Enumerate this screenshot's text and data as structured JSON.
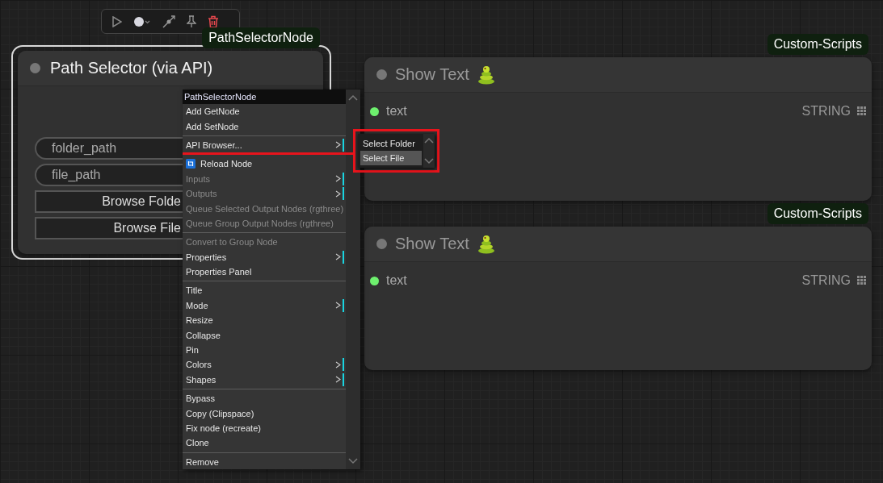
{
  "nodes": [
    {
      "badge": "PathSelectorNode",
      "title": "Path Selector (via API)",
      "selected": true,
      "widgets": [
        {
          "kind": "field",
          "label": "folder_path"
        },
        {
          "kind": "field",
          "label": "file_path"
        },
        {
          "kind": "button",
          "label": "Browse Folde"
        },
        {
          "kind": "button",
          "label": "Browse File"
        }
      ]
    },
    {
      "badge": "Custom-Scripts",
      "title": "Show Text",
      "selected": false,
      "inputs": [
        {
          "label": "text"
        }
      ],
      "outputs": [
        {
          "label": "STRING"
        }
      ]
    },
    {
      "badge": "Custom-Scripts",
      "title": "Show Text",
      "selected": false,
      "inputs": [
        {
          "label": "text"
        }
      ],
      "outputs": [
        {
          "label": "STRING"
        }
      ]
    }
  ],
  "context_menu": {
    "title": "PathSelectorNode",
    "items": [
      {
        "kind": "item",
        "label": "Add GetNode",
        "disabled": false,
        "submenu": false
      },
      {
        "kind": "item",
        "label": "Add SetNode",
        "disabled": false,
        "submenu": false
      },
      {
        "kind": "separator"
      },
      {
        "kind": "item",
        "label": "API Browser...",
        "disabled": false,
        "submenu": true
      },
      {
        "kind": "separator"
      },
      {
        "kind": "icon-item",
        "label": "Reload Node",
        "disabled": false,
        "submenu": false
      },
      {
        "kind": "item",
        "label": "Inputs",
        "disabled": true,
        "submenu": true
      },
      {
        "kind": "item",
        "label": "Outputs",
        "disabled": true,
        "submenu": true
      },
      {
        "kind": "item",
        "label": "Queue Selected Output Nodes (rgthree)",
        "disabled": true,
        "submenu": false
      },
      {
        "kind": "item",
        "label": "Queue Group Output Nodes (rgthree)",
        "disabled": true,
        "submenu": false
      },
      {
        "kind": "separator"
      },
      {
        "kind": "item",
        "label": "Convert to Group Node",
        "disabled": true,
        "submenu": false
      },
      {
        "kind": "item",
        "label": "Properties",
        "disabled": false,
        "submenu": true
      },
      {
        "kind": "item",
        "label": "Properties Panel",
        "disabled": false,
        "submenu": false
      },
      {
        "kind": "separator"
      },
      {
        "kind": "item",
        "label": "Title",
        "disabled": false,
        "submenu": false
      },
      {
        "kind": "item",
        "label": "Mode",
        "disabled": false,
        "submenu": true
      },
      {
        "kind": "item",
        "label": "Resize",
        "disabled": false,
        "submenu": false
      },
      {
        "kind": "item",
        "label": "Collapse",
        "disabled": false,
        "submenu": false
      },
      {
        "kind": "item",
        "label": "Pin",
        "disabled": false,
        "submenu": false
      },
      {
        "kind": "item",
        "label": "Colors",
        "disabled": false,
        "submenu": true
      },
      {
        "kind": "item",
        "label": "Shapes",
        "disabled": false,
        "submenu": true
      },
      {
        "kind": "separator"
      },
      {
        "kind": "item",
        "label": "Bypass",
        "disabled": false,
        "submenu": false
      },
      {
        "kind": "item",
        "label": "Copy (Clipspace)",
        "disabled": false,
        "submenu": false
      },
      {
        "kind": "item",
        "label": "Fix node (recreate)",
        "disabled": false,
        "submenu": false
      },
      {
        "kind": "item",
        "label": "Clone",
        "disabled": false,
        "submenu": false
      },
      {
        "kind": "separator"
      },
      {
        "kind": "item",
        "label": "Remove",
        "disabled": false,
        "submenu": false
      }
    ]
  },
  "submenu": {
    "items": [
      {
        "label": "Select Folder",
        "selected": false
      },
      {
        "label": "Select File",
        "selected": true
      }
    ]
  }
}
